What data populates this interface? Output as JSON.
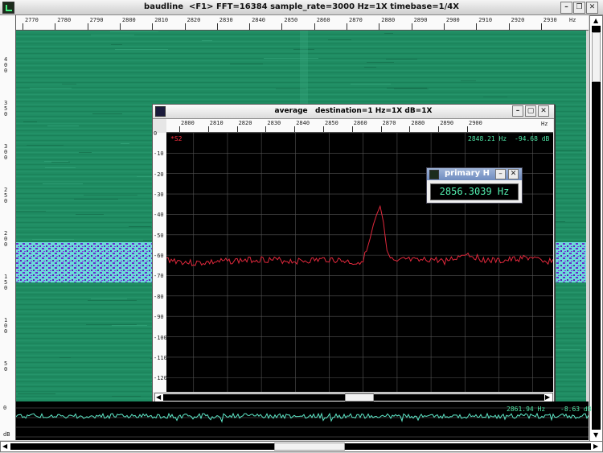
{
  "window": {
    "title": "baudline  <F1> FFT=16384 sample_rate=3000 Hz=1X timebase=1/4X",
    "buttons": [
      "–",
      "❐",
      "✕"
    ]
  },
  "main_ruler": {
    "unit": "Hz",
    "ticks": [
      "2770",
      "2780",
      "2790",
      "2800",
      "2810",
      "2820",
      "2830",
      "2840",
      "2850",
      "2860",
      "2870",
      "2880",
      "2890",
      "2900",
      "2910",
      "2920",
      "2930"
    ]
  },
  "side_ruler": {
    "ticks": [
      "400",
      "350",
      "300",
      "250",
      "200",
      "150",
      "100",
      "50"
    ]
  },
  "average_window": {
    "title": "average   destination=1 Hz=1X dB=1X",
    "ruler_unit": "Hz",
    "ruler_ticks": [
      "2800",
      "2810",
      "2820",
      "2830",
      "2840",
      "2850",
      "2860",
      "2870",
      "2880",
      "2890",
      "2900"
    ],
    "y_ticks": [
      "0",
      "-10",
      "-20",
      "-30",
      "-40",
      "-50",
      "-60",
      "-70",
      "-80",
      "-90",
      "-100",
      "-110",
      "-120"
    ],
    "cursor_label": "*S2",
    "readout_freq": "2848.21 Hz",
    "readout_db": "-94.68 dB"
  },
  "popup": {
    "title": "primary H",
    "value": "2856.3039 Hz"
  },
  "bottom_panel": {
    "y_labels": [
      "0",
      "dB"
    ],
    "readout_freq": "2861.94 Hz",
    "readout_db": "-8.63 dB"
  },
  "colors": {
    "spectrogram_base": "#1d8a60",
    "band_cyan": "#67d8d8",
    "band_purple": "#6b2ad0",
    "trace_red": "#e0283c",
    "trace_cyan": "#5ee8c8",
    "readout_green": "#50e8a8",
    "cursor_red": "#ff3040"
  },
  "chart_data": {
    "type": "line",
    "title": "average   destination=1 Hz=1X dB=1X",
    "xlabel": "Hz",
    "ylabel": "dB",
    "xlim": [
      2792,
      2906
    ],
    "ylim": [
      -127,
      0
    ],
    "series": [
      {
        "color": "#e0283c",
        "x": [
          2792,
          2800,
          2810,
          2820,
          2830,
          2840,
          2845,
          2848,
          2850,
          2851,
          2852,
          2853,
          2854,
          2855,
          2856,
          2857,
          2858,
          2860,
          2862,
          2866,
          2870,
          2874,
          2878,
          2880,
          2885,
          2890,
          2895,
          2900,
          2903,
          2906
        ],
        "y": [
          -62,
          -64,
          -63,
          -62,
          -63,
          -62,
          -63,
          -64,
          -62,
          -58,
          -52,
          -45,
          -40,
          -36,
          -44,
          -58,
          -62,
          -64,
          -62,
          -63,
          -62,
          -63,
          -61,
          -59,
          -62,
          -63,
          -62,
          -61,
          -64,
          -62
        ]
      }
    ]
  }
}
